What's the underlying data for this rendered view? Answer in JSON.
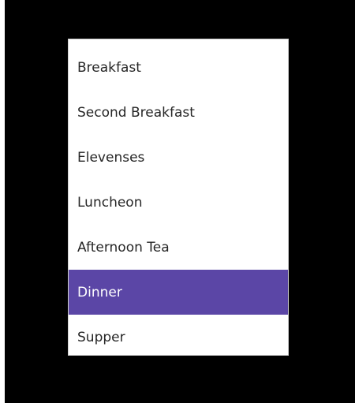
{
  "menu": {
    "items": [
      {
        "label": "Breakfast"
      },
      {
        "label": "Second Breakfast"
      },
      {
        "label": "Elevenses"
      },
      {
        "label": "Luncheon"
      },
      {
        "label": "Afternoon Tea"
      },
      {
        "label": "Dinner",
        "selected": true
      },
      {
        "label": "Supper"
      }
    ]
  },
  "colors": {
    "background": "#000000",
    "list_background": "#ffffff",
    "selected_background": "#5b46a6",
    "selected_text": "#ffffff",
    "text": "#262626"
  }
}
